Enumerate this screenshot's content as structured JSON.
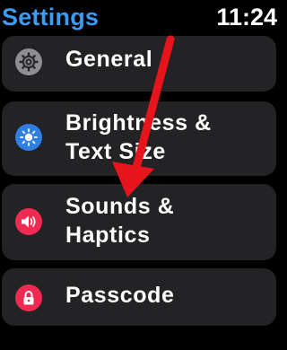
{
  "status": {
    "title": "Settings",
    "time": "11:24"
  },
  "menu": {
    "items": [
      {
        "label_line1": "General",
        "label_line2": "",
        "icon": "gear-icon",
        "icon_color": "#8e8e93"
      },
      {
        "label_line1": "Brightness &",
        "label_line2": "Text Size",
        "icon": "sun-icon",
        "icon_color": "#2f7fe5"
      },
      {
        "label_line1": "Sounds &",
        "label_line2": "Haptics",
        "icon": "speaker-icon",
        "icon_color": "#f02a52"
      },
      {
        "label_line1": "Passcode",
        "label_line2": "",
        "icon": "lock-icon",
        "icon_color": "#f02a52"
      }
    ]
  },
  "colors": {
    "title": "#3c9bf4",
    "card_background": "#232325",
    "annotation_arrow": "#e8141b"
  }
}
